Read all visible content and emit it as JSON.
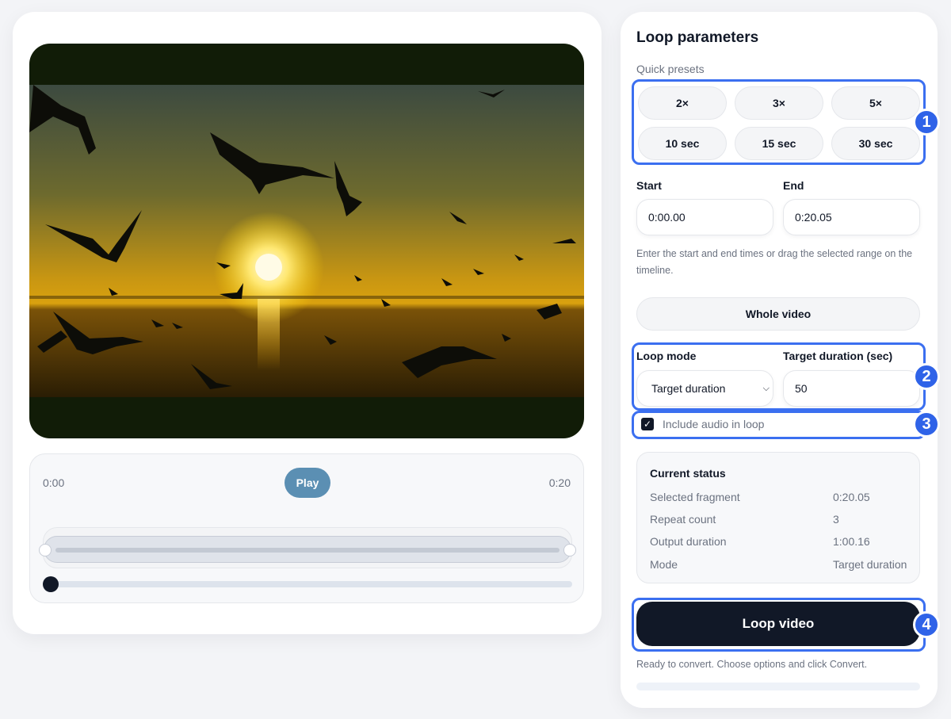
{
  "player": {
    "time_start": "0:00",
    "time_end": "0:20",
    "play_label": "Play",
    "progress_fraction": 0
  },
  "panel": {
    "title": "Loop parameters",
    "presets_label": "Quick presets",
    "presets": [
      "2×",
      "3×",
      "5×",
      "10 sec",
      "15 sec",
      "30 sec"
    ],
    "start_label": "Start",
    "start_value": "0:00.00",
    "end_label": "End",
    "end_value": "0:20.05",
    "hint": "Enter the start and end times or drag the selected range on the timeline.",
    "whole_video_label": "Whole video",
    "loop_mode_label": "Loop mode",
    "loop_mode_value": "Target duration",
    "target_duration_label": "Target duration (sec)",
    "target_duration_value": "50",
    "include_audio_label": "Include audio in loop",
    "include_audio_checked": true,
    "status_title": "Current status",
    "status_rows": [
      {
        "key": "Selected fragment",
        "value": "0:20.05"
      },
      {
        "key": "Repeat count",
        "value": "3"
      },
      {
        "key": "Output duration",
        "value": "1:00.16"
      },
      {
        "key": "Mode",
        "value": "Target duration"
      }
    ],
    "loop_button_label": "Loop video",
    "ready_text": "Ready to convert. Choose options and click Convert."
  },
  "annotations": [
    "1",
    "2",
    "3",
    "4"
  ],
  "colors": {
    "accent": "#3b6ff0",
    "badge": "#2f63e8",
    "play_button": "#5b8fb3",
    "primary_button": "#111827"
  }
}
